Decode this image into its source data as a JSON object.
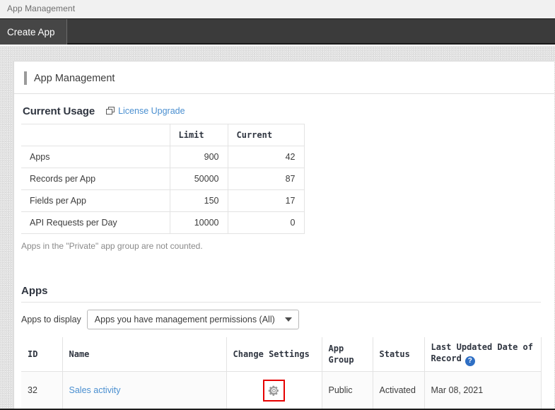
{
  "window": {
    "breadcrumb_title": "App Management"
  },
  "toolbar": {
    "create_app_label": "Create App"
  },
  "page": {
    "heading": "App Management"
  },
  "usage": {
    "section_title": "Current Usage",
    "license_link_label": "License Upgrade",
    "license_link_icon": "external-window-icon",
    "columns": [
      "",
      "Limit",
      "Current"
    ],
    "rows": [
      {
        "label": "Apps",
        "limit": "900",
        "current": "42"
      },
      {
        "label": "Records per App",
        "limit": "50000",
        "current": "87"
      },
      {
        "label": "Fields per App",
        "limit": "150",
        "current": "17"
      },
      {
        "label": "API Requests per Day",
        "limit": "10000",
        "current": "0"
      }
    ],
    "note": "Apps in the \"Private\" app group are not counted."
  },
  "apps": {
    "section_title": "Apps",
    "filter_label": "Apps to display",
    "filter_value": "Apps you have management permissions (All)",
    "filter_caret_icon": "chevron-down-icon",
    "columns": {
      "id": "ID",
      "name": "Name",
      "change_settings": "Change Settings",
      "app_group": "App Group",
      "status": "Status",
      "last_updated_line1": "Last Updated Date of",
      "last_updated_line2": "Record",
      "help_icon_label": "?"
    },
    "rows": [
      {
        "id": "32",
        "name": "Sales activity",
        "change_settings_icon": "gear-icon",
        "app_group": "Public",
        "status": "Activated",
        "last_updated": "Mar 08, 2021"
      }
    ]
  },
  "colors": {
    "link": "#4a8fd0",
    "highlight": "#e60000",
    "toolbar_bg": "#3b3b3b",
    "toolbar_tab_bg": "#464646",
    "help_badge": "#2f6fc4",
    "gear": "#999999"
  }
}
